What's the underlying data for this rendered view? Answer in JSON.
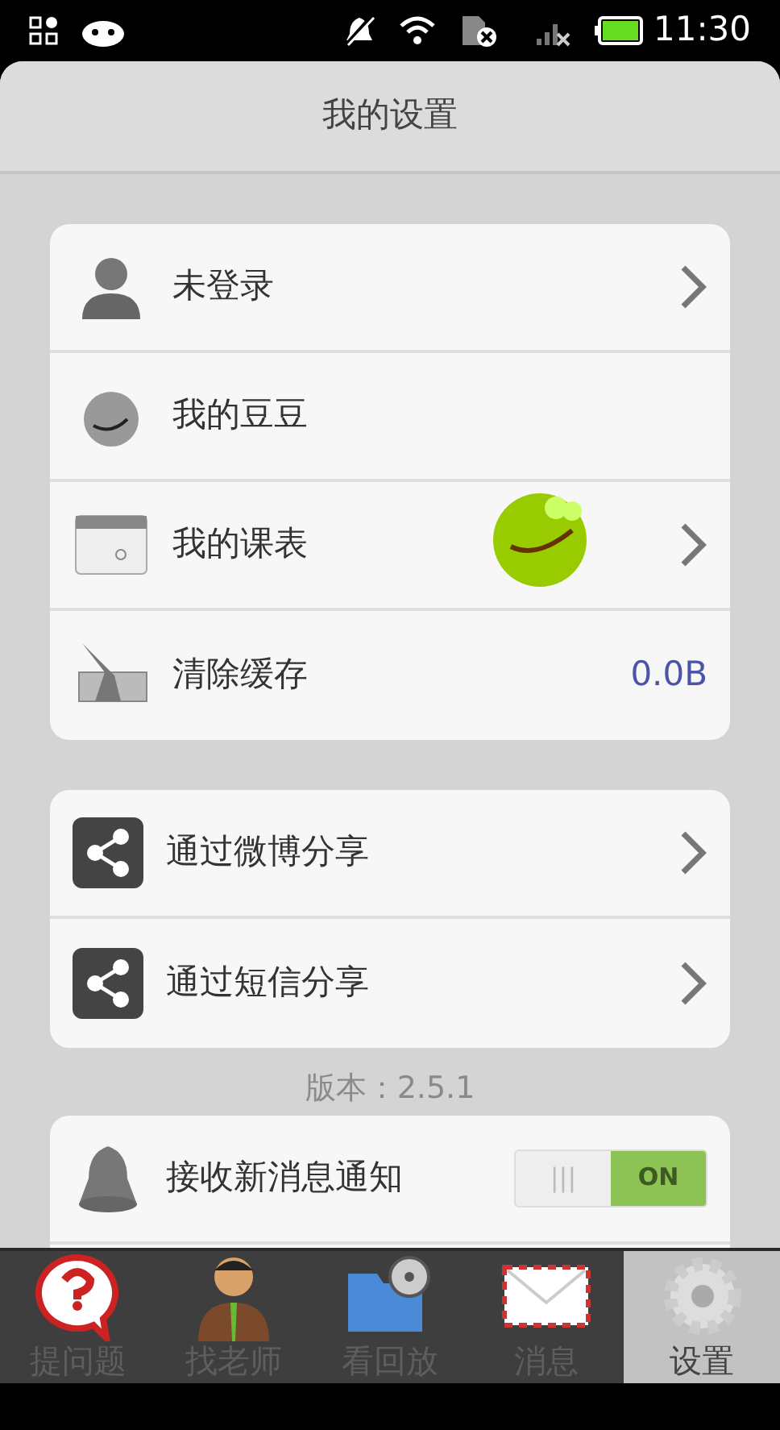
{
  "status_bar": {
    "time": "11:30"
  },
  "header": {
    "title": "我的设置"
  },
  "sections": [
    {
      "rows": [
        {
          "kind": "link",
          "label": "未登录"
        },
        {
          "kind": "plain",
          "label": "我的豆豆"
        },
        {
          "kind": "link",
          "label": "我的课表"
        },
        {
          "kind": "value",
          "label": "清除缓存",
          "value": "0.0B"
        }
      ]
    },
    {
      "rows": [
        {
          "kind": "link",
          "label": "通过微博分享"
        },
        {
          "kind": "link",
          "label": "通过短信分享"
        }
      ]
    }
  ],
  "version": "版本：2.5.1",
  "notifications": {
    "rows": [
      {
        "kind": "toggle",
        "label": "接收新消息通知",
        "on": true,
        "on_label": "ON",
        "grip": "|||"
      }
    ]
  },
  "tab_bar": [
    {
      "label": "提问题",
      "selected": false
    },
    {
      "label": "找老师",
      "selected": false
    },
    {
      "label": "看回放",
      "selected": false
    },
    {
      "label": "消息",
      "selected": false
    },
    {
      "label": "设置",
      "selected": true
    }
  ]
}
